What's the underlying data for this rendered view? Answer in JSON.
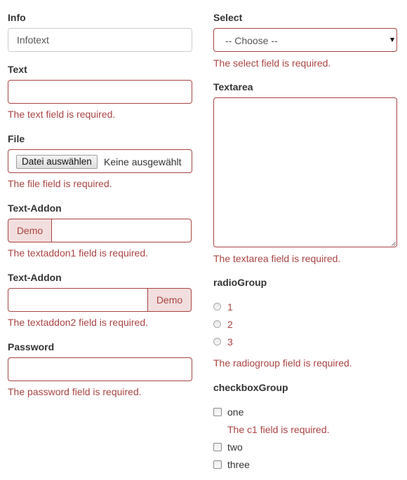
{
  "left": {
    "info": {
      "label": "Info",
      "value": "Infotext"
    },
    "text": {
      "label": "Text",
      "error": "The text field is required."
    },
    "file": {
      "label": "File",
      "button": "Datei auswählen",
      "status": "Keine ausgewählt",
      "error": "The file field is required."
    },
    "addon1": {
      "label": "Text-Addon",
      "addon": "Demo",
      "error": "The textaddon1 field is required."
    },
    "addon2": {
      "label": "Text-Addon",
      "addon": "Demo",
      "error": "The textaddon2 field is required."
    },
    "password": {
      "label": "Password",
      "error": "The password field is required."
    }
  },
  "right": {
    "select": {
      "label": "Select",
      "value": "-- Choose --",
      "error": "The select field is required."
    },
    "textarea": {
      "label": "Textarea",
      "error": "The textarea field is required."
    },
    "radio": {
      "label": "radioGroup",
      "options": [
        "1",
        "2",
        "3"
      ],
      "error": "The radiogroup field is required."
    },
    "checkbox": {
      "label": "checkboxGroup",
      "options": [
        "one",
        "two",
        "three"
      ],
      "error_one": "The c1 field is required."
    }
  },
  "colors": {
    "error": "#a94442",
    "addon_bg": "#f2dede"
  }
}
